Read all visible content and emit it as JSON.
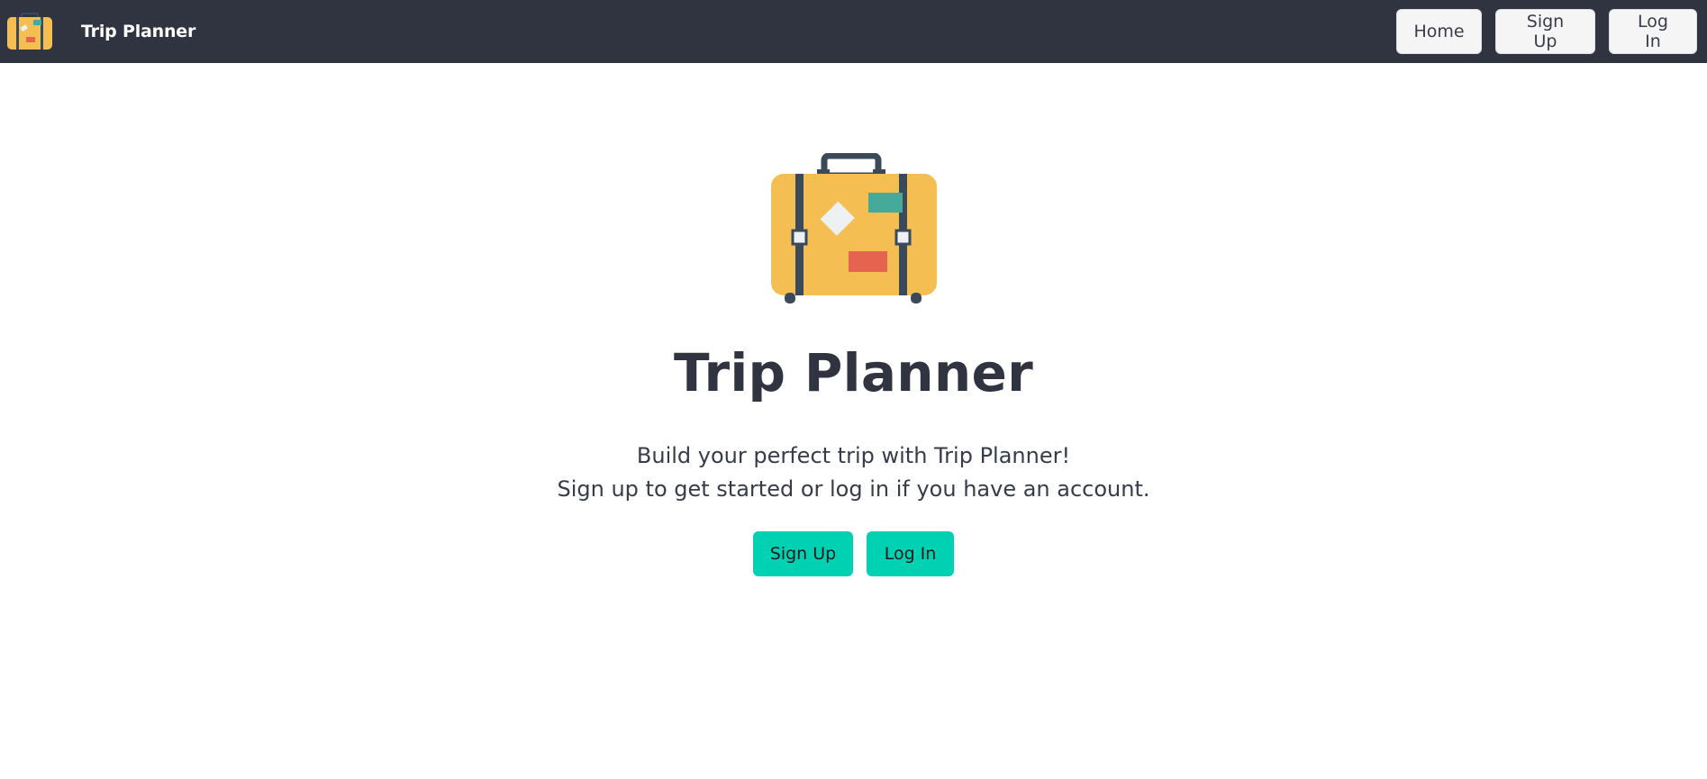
{
  "navbar": {
    "brand_text": "Trip Planner",
    "logo_icon": "suitcase-icon",
    "buttons": [
      {
        "label": "Home"
      },
      {
        "label": "Sign Up"
      },
      {
        "label": "Log In"
      }
    ]
  },
  "hero": {
    "logo_icon": "suitcase-icon",
    "title": "Trip Planner",
    "subtitle_line1": "Build your perfect trip with Trip Planner!",
    "subtitle_line2": "Sign up to get started or log in if you have an account.",
    "buttons": [
      {
        "label": "Sign Up"
      },
      {
        "label": "Log In"
      }
    ]
  },
  "colors": {
    "navbar_bg": "#2f3440",
    "accent": "#00d1b2",
    "suitcase_body": "#f5be52",
    "suitcase_strap": "#3b4a5a",
    "sticker_teal": "#46aa9a",
    "sticker_red": "#e5644f",
    "sticker_white": "#eef1f1"
  }
}
